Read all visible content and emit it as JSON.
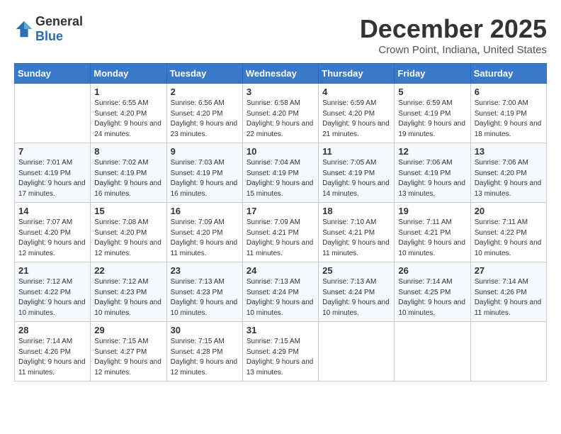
{
  "logo": {
    "general": "General",
    "blue": "Blue"
  },
  "title": "December 2025",
  "subtitle": "Crown Point, Indiana, United States",
  "weekdays": [
    "Sunday",
    "Monday",
    "Tuesday",
    "Wednesday",
    "Thursday",
    "Friday",
    "Saturday"
  ],
  "weeks": [
    [
      {
        "day": "",
        "sunrise": "",
        "sunset": "",
        "daylight": ""
      },
      {
        "day": "1",
        "sunrise": "Sunrise: 6:55 AM",
        "sunset": "Sunset: 4:20 PM",
        "daylight": "Daylight: 9 hours and 24 minutes."
      },
      {
        "day": "2",
        "sunrise": "Sunrise: 6:56 AM",
        "sunset": "Sunset: 4:20 PM",
        "daylight": "Daylight: 9 hours and 23 minutes."
      },
      {
        "day": "3",
        "sunrise": "Sunrise: 6:58 AM",
        "sunset": "Sunset: 4:20 PM",
        "daylight": "Daylight: 9 hours and 22 minutes."
      },
      {
        "day": "4",
        "sunrise": "Sunrise: 6:59 AM",
        "sunset": "Sunset: 4:20 PM",
        "daylight": "Daylight: 9 hours and 21 minutes."
      },
      {
        "day": "5",
        "sunrise": "Sunrise: 6:59 AM",
        "sunset": "Sunset: 4:19 PM",
        "daylight": "Daylight: 9 hours and 19 minutes."
      },
      {
        "day": "6",
        "sunrise": "Sunrise: 7:00 AM",
        "sunset": "Sunset: 4:19 PM",
        "daylight": "Daylight: 9 hours and 18 minutes."
      }
    ],
    [
      {
        "day": "7",
        "sunrise": "Sunrise: 7:01 AM",
        "sunset": "Sunset: 4:19 PM",
        "daylight": "Daylight: 9 hours and 17 minutes."
      },
      {
        "day": "8",
        "sunrise": "Sunrise: 7:02 AM",
        "sunset": "Sunset: 4:19 PM",
        "daylight": "Daylight: 9 hours and 16 minutes."
      },
      {
        "day": "9",
        "sunrise": "Sunrise: 7:03 AM",
        "sunset": "Sunset: 4:19 PM",
        "daylight": "Daylight: 9 hours and 16 minutes."
      },
      {
        "day": "10",
        "sunrise": "Sunrise: 7:04 AM",
        "sunset": "Sunset: 4:19 PM",
        "daylight": "Daylight: 9 hours and 15 minutes."
      },
      {
        "day": "11",
        "sunrise": "Sunrise: 7:05 AM",
        "sunset": "Sunset: 4:19 PM",
        "daylight": "Daylight: 9 hours and 14 minutes."
      },
      {
        "day": "12",
        "sunrise": "Sunrise: 7:06 AM",
        "sunset": "Sunset: 4:19 PM",
        "daylight": "Daylight: 9 hours and 13 minutes."
      },
      {
        "day": "13",
        "sunrise": "Sunrise: 7:06 AM",
        "sunset": "Sunset: 4:20 PM",
        "daylight": "Daylight: 9 hours and 13 minutes."
      }
    ],
    [
      {
        "day": "14",
        "sunrise": "Sunrise: 7:07 AM",
        "sunset": "Sunset: 4:20 PM",
        "daylight": "Daylight: 9 hours and 12 minutes."
      },
      {
        "day": "15",
        "sunrise": "Sunrise: 7:08 AM",
        "sunset": "Sunset: 4:20 PM",
        "daylight": "Daylight: 9 hours and 12 minutes."
      },
      {
        "day": "16",
        "sunrise": "Sunrise: 7:09 AM",
        "sunset": "Sunset: 4:20 PM",
        "daylight": "Daylight: 9 hours and 11 minutes."
      },
      {
        "day": "17",
        "sunrise": "Sunrise: 7:09 AM",
        "sunset": "Sunset: 4:21 PM",
        "daylight": "Daylight: 9 hours and 11 minutes."
      },
      {
        "day": "18",
        "sunrise": "Sunrise: 7:10 AM",
        "sunset": "Sunset: 4:21 PM",
        "daylight": "Daylight: 9 hours and 11 minutes."
      },
      {
        "day": "19",
        "sunrise": "Sunrise: 7:11 AM",
        "sunset": "Sunset: 4:21 PM",
        "daylight": "Daylight: 9 hours and 10 minutes."
      },
      {
        "day": "20",
        "sunrise": "Sunrise: 7:11 AM",
        "sunset": "Sunset: 4:22 PM",
        "daylight": "Daylight: 9 hours and 10 minutes."
      }
    ],
    [
      {
        "day": "21",
        "sunrise": "Sunrise: 7:12 AM",
        "sunset": "Sunset: 4:22 PM",
        "daylight": "Daylight: 9 hours and 10 minutes."
      },
      {
        "day": "22",
        "sunrise": "Sunrise: 7:12 AM",
        "sunset": "Sunset: 4:23 PM",
        "daylight": "Daylight: 9 hours and 10 minutes."
      },
      {
        "day": "23",
        "sunrise": "Sunrise: 7:13 AM",
        "sunset": "Sunset: 4:23 PM",
        "daylight": "Daylight: 9 hours and 10 minutes."
      },
      {
        "day": "24",
        "sunrise": "Sunrise: 7:13 AM",
        "sunset": "Sunset: 4:24 PM",
        "daylight": "Daylight: 9 hours and 10 minutes."
      },
      {
        "day": "25",
        "sunrise": "Sunrise: 7:13 AM",
        "sunset": "Sunset: 4:24 PM",
        "daylight": "Daylight: 9 hours and 10 minutes."
      },
      {
        "day": "26",
        "sunrise": "Sunrise: 7:14 AM",
        "sunset": "Sunset: 4:25 PM",
        "daylight": "Daylight: 9 hours and 10 minutes."
      },
      {
        "day": "27",
        "sunrise": "Sunrise: 7:14 AM",
        "sunset": "Sunset: 4:26 PM",
        "daylight": "Daylight: 9 hours and 11 minutes."
      }
    ],
    [
      {
        "day": "28",
        "sunrise": "Sunrise: 7:14 AM",
        "sunset": "Sunset: 4:26 PM",
        "daylight": "Daylight: 9 hours and 11 minutes."
      },
      {
        "day": "29",
        "sunrise": "Sunrise: 7:15 AM",
        "sunset": "Sunset: 4:27 PM",
        "daylight": "Daylight: 9 hours and 12 minutes."
      },
      {
        "day": "30",
        "sunrise": "Sunrise: 7:15 AM",
        "sunset": "Sunset: 4:28 PM",
        "daylight": "Daylight: 9 hours and 12 minutes."
      },
      {
        "day": "31",
        "sunrise": "Sunrise: 7:15 AM",
        "sunset": "Sunset: 4:29 PM",
        "daylight": "Daylight: 9 hours and 13 minutes."
      },
      {
        "day": "",
        "sunrise": "",
        "sunset": "",
        "daylight": ""
      },
      {
        "day": "",
        "sunrise": "",
        "sunset": "",
        "daylight": ""
      },
      {
        "day": "",
        "sunrise": "",
        "sunset": "",
        "daylight": ""
      }
    ]
  ]
}
